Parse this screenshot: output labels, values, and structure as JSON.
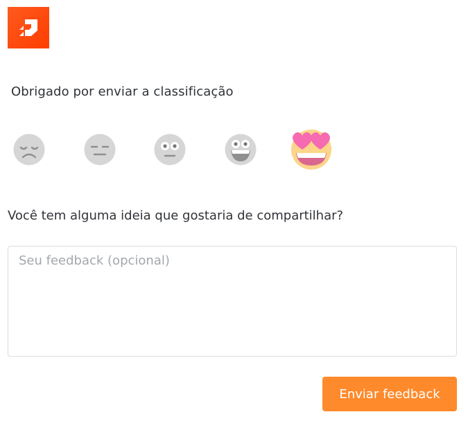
{
  "brand": {
    "logo_icon": "brand-logo-icon",
    "logo_color": "#ff4a12"
  },
  "rating": {
    "thanks_text": "Obrigado por enviar a classificação",
    "selected_index": 4,
    "faces": [
      {
        "icon": "sad-face-icon",
        "selected": false
      },
      {
        "icon": "unamused-face-icon",
        "selected": false
      },
      {
        "icon": "neutral-face-icon",
        "selected": false
      },
      {
        "icon": "grinning-face-icon",
        "selected": false
      },
      {
        "icon": "heart-eyes-face-icon",
        "selected": true
      }
    ]
  },
  "feedback": {
    "question": "Você tem alguma ideia que gostaria de compartilhar?",
    "placeholder": "Seu feedback (opcional)",
    "value": ""
  },
  "actions": {
    "submit_label": "Enviar feedback",
    "submit_color": "#ff8a2c"
  }
}
